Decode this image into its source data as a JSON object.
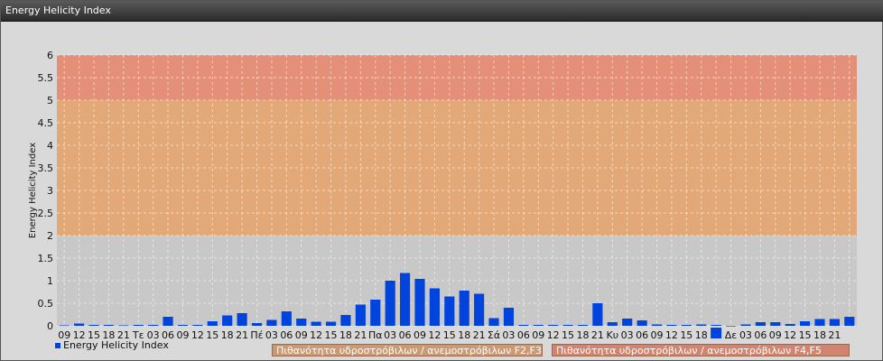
{
  "window": {
    "title": "Energy Helicity Index"
  },
  "colors": {
    "bar": "#0044dd",
    "zone_low": "#c8c8c8",
    "zone_mid": "#e2a877",
    "zone_high": "#e48f78",
    "zone_f23_box": "#c99a74",
    "zone_f45_box": "#d2856e"
  },
  "zones": {
    "f23_label": "Πιθανότητα υδροστρόβιλων / ανεμοστρόβιλων F2,F3",
    "f45_label": "Πιθανότητα υδροστρόβιλων / ανεμοστρόβιλων F4,F5"
  },
  "chart_data": {
    "type": "bar",
    "ylabel": "Energy Helicity Index",
    "ylim": [
      0,
      6
    ],
    "yticks": [
      "0",
      "0.5",
      "1",
      "1.5",
      "2",
      "2.5",
      "3",
      "3.5",
      "4",
      "4.5",
      "5",
      "5.5",
      "6"
    ],
    "grid": true,
    "legend": "bottom-left",
    "bands": [
      {
        "from": 0,
        "to": 2
      },
      {
        "from": 2,
        "to": 5
      },
      {
        "from": 5,
        "to": 6
      }
    ],
    "series": [
      {
        "name": "Energy Helicity Index",
        "values": [
          0.01,
          0.05,
          0.02,
          0.02,
          0.01,
          0.02,
          0.02,
          0.2,
          0.02,
          0.02,
          0.1,
          0.23,
          0.28,
          0.06,
          0.13,
          0.32,
          0.16,
          0.09,
          0.09,
          0.24,
          0.47,
          0.58,
          1.0,
          1.17,
          1.04,
          0.83,
          0.65,
          0.78,
          0.71,
          0.17,
          0.4,
          0.02,
          0.02,
          0.02,
          0.02,
          0.02,
          0.5,
          0.08,
          0.16,
          0.12,
          0.03,
          0.02,
          0.02,
          0.03,
          0.02,
          0.0,
          0.03,
          0.08,
          0.08,
          0.04,
          0.1,
          0.15,
          0.15,
          0.2
        ]
      }
    ],
    "categories": [
      "09",
      "12",
      "15",
      "18",
      "21",
      "Τε",
      "03",
      "06",
      "09",
      "12",
      "15",
      "18",
      "21",
      "Πέ",
      "03",
      "06",
      "09",
      "12",
      "15",
      "18",
      "21",
      "Πα",
      "03",
      "06",
      "09",
      "12",
      "15",
      "18",
      "21",
      "Σά",
      "03",
      "06",
      "09",
      "12",
      "15",
      "18",
      "21",
      "Κυ",
      "03",
      "06",
      "09",
      "12",
      "15",
      "18",
      "",
      "Δε",
      "03",
      "06",
      "09",
      "12",
      "15",
      "18",
      "21",
      ""
    ],
    "legend_marker_index": 44
  }
}
